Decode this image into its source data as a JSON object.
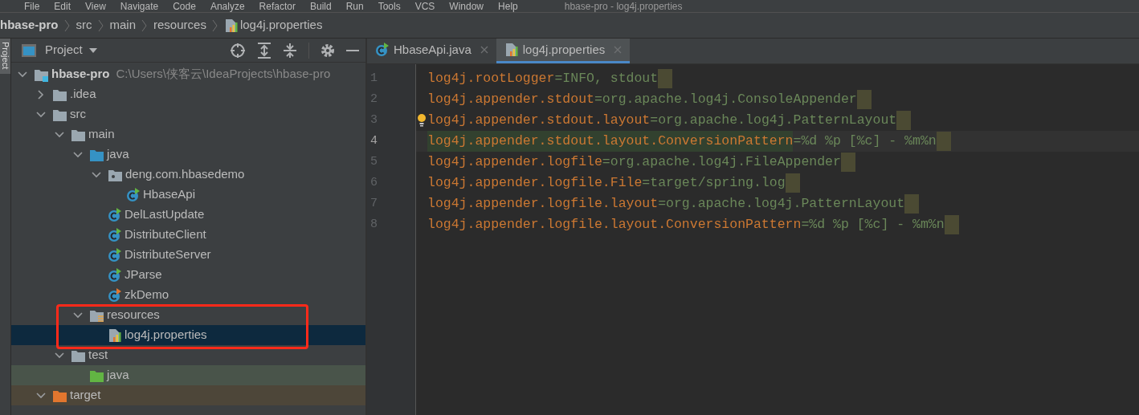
{
  "menu_bar": {
    "items": [
      "File",
      "Edit",
      "View",
      "Navigate",
      "Code",
      "Analyze",
      "Refactor",
      "Build",
      "Run",
      "Tools",
      "VCS",
      "Window",
      "Help"
    ],
    "title": "hbase-pro - log4j.properties"
  },
  "breadcrumbs": [
    {
      "label": "hbase-pro",
      "kind": "project"
    },
    {
      "label": "src",
      "kind": "folder"
    },
    {
      "label": "main",
      "kind": "folder"
    },
    {
      "label": "resources",
      "kind": "folder"
    },
    {
      "label": "log4j.properties",
      "kind": "properties"
    }
  ],
  "side_strip": {
    "label": "Project"
  },
  "project_panel": {
    "title": "Project",
    "tree": [
      {
        "label": "hbase-pro",
        "path": "C:\\Users\\侠客云\\IdeaProjects\\hbase-pro",
        "kind": "module",
        "expanded": true,
        "selected": false,
        "children": [
          {
            "label": ".idea",
            "kind": "folder",
            "expanded": false,
            "selected": false
          },
          {
            "label": "src",
            "kind": "folder",
            "expanded": true,
            "selected": false,
            "children": [
              {
                "label": "main",
                "kind": "folder",
                "expanded": true,
                "selected": false,
                "children": [
                  {
                    "label": "java",
                    "kind": "source-folder",
                    "expanded": true,
                    "selected": false,
                    "children": [
                      {
                        "label": "deng.com.hbasedemo",
                        "kind": "package",
                        "expanded": true,
                        "selected": false,
                        "children": [
                          {
                            "label": "HbaseApi",
                            "kind": "class",
                            "selected": false
                          }
                        ]
                      },
                      {
                        "label": "DelLastUpdate",
                        "kind": "class",
                        "selected": false
                      },
                      {
                        "label": "DistributeClient",
                        "kind": "class",
                        "selected": false
                      },
                      {
                        "label": "DistributeServer",
                        "kind": "class",
                        "selected": false
                      },
                      {
                        "label": "JParse",
                        "kind": "class",
                        "selected": false
                      },
                      {
                        "label": "zkDemo",
                        "kind": "class-alert",
                        "selected": false
                      }
                    ]
                  },
                  {
                    "label": "resources",
                    "kind": "resource-folder",
                    "expanded": true,
                    "selected": false,
                    "children": [
                      {
                        "label": "log4j.properties",
                        "kind": "properties",
                        "selected": true
                      }
                    ]
                  }
                ]
              },
              {
                "label": "test",
                "kind": "folder",
                "expanded": true,
                "selected": false,
                "children": [
                  {
                    "label": "java",
                    "kind": "test-folder",
                    "selected": false
                  }
                ]
              }
            ]
          },
          {
            "label": "target",
            "kind": "excluded-folder",
            "expanded": true,
            "selected": false
          }
        ]
      }
    ]
  },
  "tabs": [
    {
      "label": "HbaseApi.java",
      "kind": "class",
      "selected": false
    },
    {
      "label": "log4j.properties",
      "kind": "properties",
      "selected": true
    }
  ],
  "editor": {
    "lines": [
      {
        "number": "1",
        "key": "log4j.rootLogger",
        "sep": "=",
        "value": "INFO, stdout",
        "current": false
      },
      {
        "number": "2",
        "key": "log4j.appender.stdout",
        "sep": "=",
        "value": "org.apache.log4j.ConsoleAppender",
        "current": false
      },
      {
        "number": "3",
        "key": "log4j.appender.stdout.layout",
        "sep": "=",
        "value": "org.apache.log4j.PatternLayout",
        "current": false,
        "bulb": true
      },
      {
        "number": "4",
        "key": "log4j.appender.stdout.layout.ConversionPattern",
        "sep": "=",
        "value": "%d %p [%c] - %m%n",
        "current": true,
        "highlighted": true
      },
      {
        "number": "5",
        "key": "log4j.appender.logfile",
        "sep": "=",
        "value": "org.apache.log4j.FileAppender",
        "current": false
      },
      {
        "number": "6",
        "key": "log4j.appender.logfile.File",
        "sep": "=",
        "value": "target/spring.log",
        "current": false
      },
      {
        "number": "7",
        "key": "log4j.appender.logfile.layout",
        "sep": "=",
        "value": "org.apache.log4j.PatternLayout",
        "current": false
      },
      {
        "number": "8",
        "key": "log4j.appender.logfile.layout.ConversionPattern",
        "sep": "=",
        "value": "%d %p [%c] - %m%n",
        "current": false
      }
    ]
  }
}
